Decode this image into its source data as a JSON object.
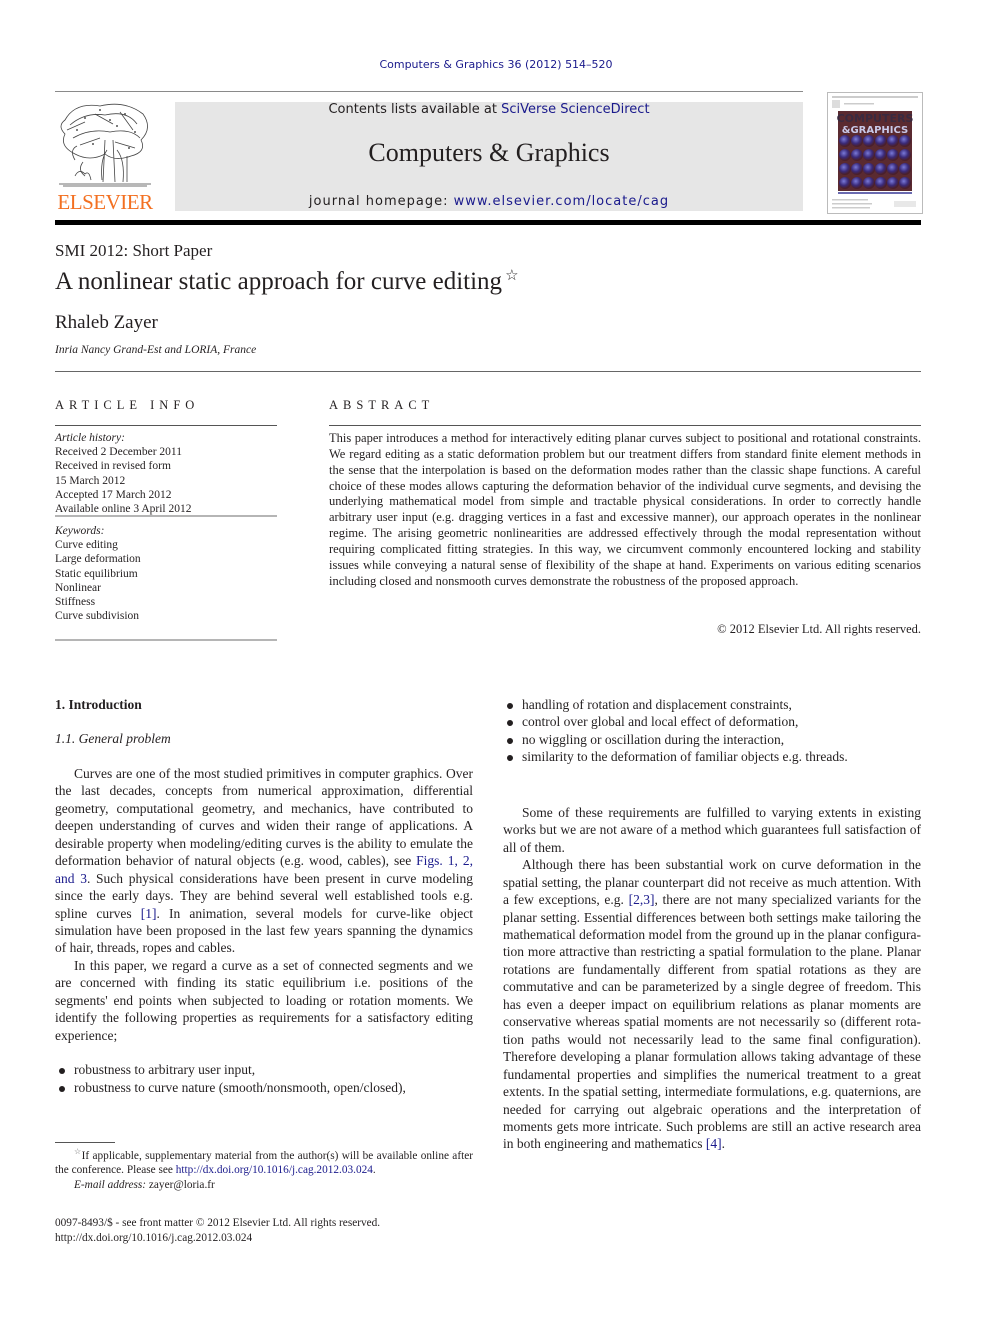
{
  "running_head": "Computers & Graphics 36 (2012) 514–520",
  "masthead": {
    "publisher_wordmark": "ELSEVIER",
    "contents_prefix": "Contents lists available at ",
    "contents_link": "SciVerse ScienceDirect",
    "journal_title": "Computers & Graphics",
    "homepage_prefix": "journal homepage: ",
    "homepage_link": "www.elsevier.com/locate/cag",
    "cover_title_line1": "COMPUTERS",
    "cover_title_line2": "&GRAPHICS"
  },
  "article": {
    "type": "SMI 2012: Short Paper",
    "title": "A nonlinear static approach for curve editing",
    "title_mark": "☆",
    "author": "Rhaleb Zayer",
    "affiliation": "Inria Nancy Grand-Est and LORIA, France"
  },
  "article_info": {
    "heading": "ARTICLE INFO",
    "history_label": "Article history:",
    "history": [
      "Received 2 December 2011",
      "Received in revised form",
      "15 March 2012",
      "Accepted 17 March 2012",
      "Available online 3 April 2012"
    ],
    "keywords_label": "Keywords:",
    "keywords": [
      "Curve editing",
      "Large deformation",
      "Static equilibrium",
      "Nonlinear",
      "Stiffness",
      "Curve subdivision"
    ]
  },
  "abstract": {
    "heading": "ABSTRACT",
    "text": "This paper introduces a method for interactively editing planar curves subject to positional and rotational constraints. We regard editing as a static deformation problem but our treatment differs from standard finite element methods in the sense that the interpolation is based on the deformation modes rather than the classic shape functions. A careful choice of these modes allows capturing the deformation behavior of the individual curve segments, and devising the underlying mathematical model from simple and tractable physical considerations. In order to correctly handle arbitrary user input (e.g. dragging vertices in a fast and excessive manner), our approach operates in the nonlinear regime. The arising geometric nonlinearities are addressed effectively through the modal representa­tion without requiring complicated fitting strategies. In this way, we circumvent commonly encoun­tered locking and stability issues while conveying a natural sense of flexibility of the shape at hand. Experiments on various editing scenarios including closed and nonsmooth curves demonstrate the robustness of the proposed approach.",
    "copyright": "© 2012 Elsevier Ltd. All rights reserved."
  },
  "body": {
    "section_heading": "1.  Introduction",
    "subsection_heading": "1.1.  General problem",
    "p1_a": "Curves are one of the most studied primitives in computer graphics. Over the last decades, concepts from numerical approx­imation, differential geometry, computational geometry, and mechanics, have contributed to deepen understanding of curves and widen their range of applications. A desirable property when modeling/editing curves is the ability to emulate the deformation behavior of natural objects (e.g. wood, cables), see ",
    "p1_link_figs": "Figs. 1, 2, and 3",
    "p1_b": ". Such physical considerations have been present in curve modeling since the early days. They are behind several well established tools e.g. spline curves ",
    "p1_link_ref1": "[1]",
    "p1_c": ". In animation, several models for curve-like object simulation have been proposed in the last few years spanning the dynamics of hair, threads, ropes and cables.",
    "p2": "In this paper, we regard a curve as a set of connected segments and we are concerned with finding its static equilibrium i.e. positions of the segments' end points when subjected to loading or rotation moments. We identify the following properties as requirements for a satisfactory editing experience;",
    "bullets_left": [
      "robustness to arbitrary user input,",
      "robustness to curve nature (smooth/nonsmooth, open/closed),"
    ],
    "bullets_right": [
      "handling of rotation and displacement constraints,",
      "control over global and local effect of deformation,",
      "no wiggling or oscillation during the interaction,",
      "similarity to the deformation of familiar objects e.g. threads."
    ],
    "p3": "Some of these requirements are fulfilled to varying extents in existing works but we are not aware of a method which guarantees full satisfaction of all of them.",
    "p4_a": "Although there has been substantial work on curve deforma­tion in the spatial setting, the planar counterpart did not receive as much attention. With a few exceptions, e.g. ",
    "p4_link_ref23": "[2,3]",
    "p4_b": ", there are not many specialized variants for the planar setting. Essential differ­ences between both settings make tailoring the mathematical deformation model from the ground up in the planar configura­tion more attractive than restricting a spatial formulation to the plane. Planar rotations are fundamentally different from spatial rotations as they are commutative and can be parameterized by a single degree of freedom. This has even a deeper impact on equilibrium relations as planar moments are conservative whereas spatial moments are not necessarily so (different rota­tion paths would not necessarily lead to the same final config­uration). Therefore developing a planar formulation allows taking advantage of these fundamental properties and simplifies the numerical treatment to a great extents. In the spatial setting, intermediate formulations, e.g. quaternions, are needed for carry­ing out algebraic operations and the interpretation of moments gets more intricate. Such problems are still an active research area in both engineering and mathematics ",
    "p4_link_ref4": "[4]",
    "p4_c": "."
  },
  "footnote": {
    "mark": "☆",
    "text_a": "If applicable, supplementary material from the author(s) will be available online after the conference. Please see ",
    "link": "http://dx.doi.org/10.1016/j.cag.2012.03.024",
    "text_b": ".",
    "email_label": "E-mail address: ",
    "email": "zayer@loria.fr"
  },
  "front_matter": {
    "issn_line": "0097-8493/$ - see front matter © 2012 Elsevier Ltd. All rights reserved.",
    "doi": "http://dx.doi.org/10.1016/j.cag.2012.03.024"
  },
  "colors": {
    "link": "#1a1a8c",
    "elsevier_orange": "#f37021",
    "masthead_grey": "#e6e6e6"
  }
}
